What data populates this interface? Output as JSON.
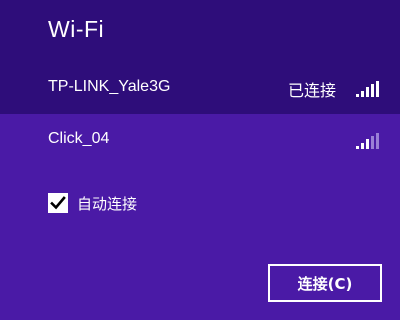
{
  "header": {
    "title": "Wi-Fi"
  },
  "networks": [
    {
      "name": "TP-LINK_Yale3G",
      "status": "已连接",
      "icon": "wifi-signal-icon",
      "signal_bars": 5,
      "signal_level": 5
    },
    {
      "name": "Click_04",
      "status": "",
      "icon": "wifi-signal-icon",
      "signal_bars": 5,
      "signal_level": 3
    }
  ],
  "auto_connect": {
    "label": "自动连接",
    "checked": true,
    "icon": "checkmark-icon"
  },
  "actions": {
    "connect_label": "连接(C)"
  },
  "colors": {
    "background": "#4a1aa6",
    "connected_band": "#2e0d7a",
    "text": "#ffffff",
    "signal_inactive": "#9a7fd6"
  }
}
